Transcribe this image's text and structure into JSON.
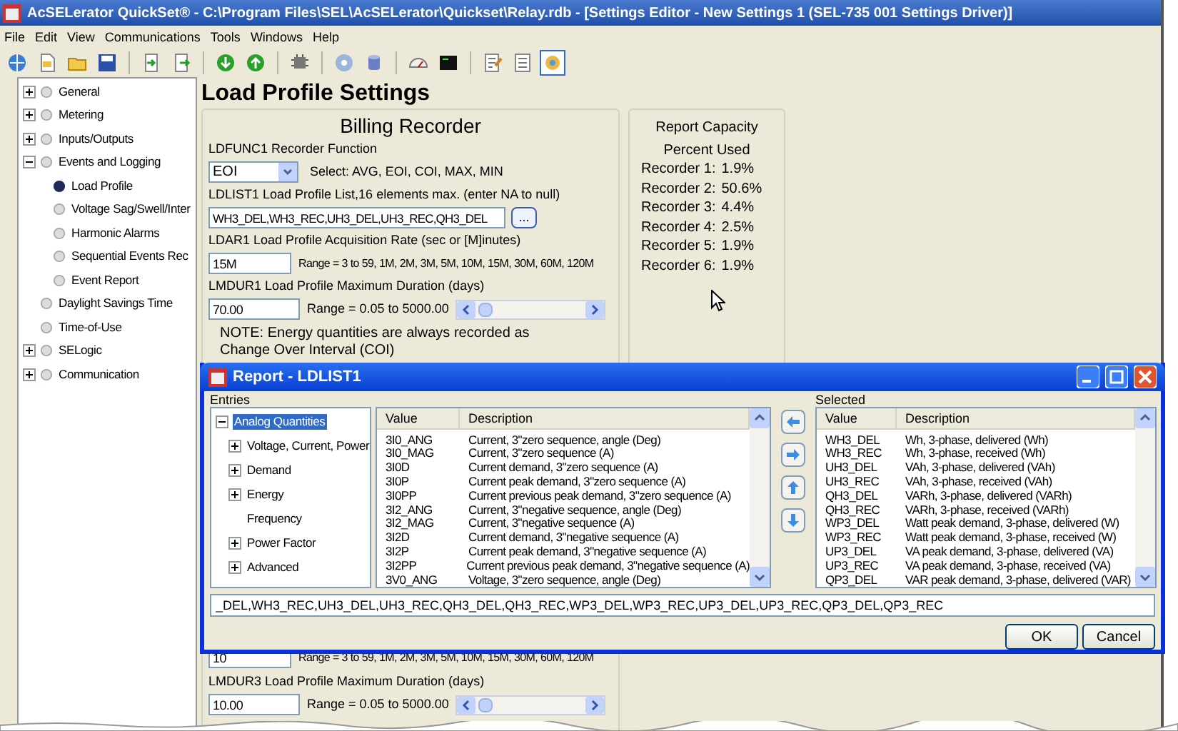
{
  "window": {
    "title": "AcSELerator QuickSet® - C:\\Program Files\\SEL\\AcSELerator\\Quickset\\Relay.rdb - [Settings Editor - New Settings 1 (SEL-735 001 Settings Driver)]"
  },
  "menu": [
    "File",
    "Edit",
    "View",
    "Communications",
    "Tools",
    "Windows",
    "Help"
  ],
  "toolbar": [
    {
      "kind": "button",
      "selected": false
    },
    {
      "kind": "button",
      "selected": false
    },
    {
      "kind": "button",
      "selected": false
    },
    {
      "kind": "button",
      "selected": false
    },
    {
      "kind": "separator"
    },
    {
      "kind": "button",
      "selected": false
    },
    {
      "kind": "button",
      "selected": false
    },
    {
      "kind": "separator"
    },
    {
      "kind": "button",
      "selected": false
    },
    {
      "kind": "button",
      "selected": false
    },
    {
      "kind": "separator"
    },
    {
      "kind": "button",
      "selected": false
    },
    {
      "kind": "separator"
    },
    {
      "kind": "button",
      "selected": false
    },
    {
      "kind": "button",
      "selected": false
    },
    {
      "kind": "separator"
    },
    {
      "kind": "button",
      "selected": false
    },
    {
      "kind": "button",
      "selected": false
    },
    {
      "kind": "separator"
    },
    {
      "kind": "button",
      "selected": false
    },
    {
      "kind": "button",
      "selected": false
    },
    {
      "kind": "button",
      "selected": true
    }
  ],
  "tree": [
    {
      "label": "General",
      "expanded": false,
      "selected": false
    },
    {
      "label": "Metering",
      "expanded": false,
      "selected": false
    },
    {
      "label": "Inputs/Outputs",
      "expanded": false,
      "selected": false
    },
    {
      "label": "Events and Logging",
      "expanded": true,
      "selected": false,
      "children": [
        {
          "label": "Load Profile",
          "selected": true
        },
        {
          "label": "Voltage Sag/Swell/Inter",
          "selected": false
        },
        {
          "label": "Harmonic Alarms",
          "selected": false
        },
        {
          "label": "Sequential Events Rec",
          "selected": false
        },
        {
          "label": "Event Report",
          "selected": false
        }
      ]
    },
    {
      "label": "Daylight Savings Time",
      "selected": false
    },
    {
      "label": "Time-of-Use",
      "selected": false
    },
    {
      "label": "SELogic",
      "expanded": false,
      "selected": false
    },
    {
      "label": "Communication",
      "expanded": false,
      "selected": false
    }
  ],
  "page_title": "Load Profile Settings",
  "billing_recorder": {
    "title": "Billing Recorder",
    "rows": [
      {
        "kind": "combo",
        "label": "LDFUNC1 Recorder Function",
        "value": "EOI",
        "hint": "Select: AVG, EOI, COI, MAX, MIN"
      },
      {
        "kind": "list",
        "label": "LDLIST1 Load Profile List,16 elements max. (enter NA to null)",
        "value": "WH3_DEL,WH3_REC,UH3_DEL,UH3_REC,QH3_DEL",
        "button": "..."
      },
      {
        "kind": "text",
        "label": "LDAR1 Load Profile Acquisition Rate (sec or [M]inutes)",
        "value": "15M",
        "hint": "Range = 3 to 59, 1M, 2M, 3M, 5M, 10M, 15M, 30M, 60M, 120M"
      },
      {
        "kind": "slider",
        "label": "LMDUR1 Load Profile Maximum Duration (days)",
        "value": "70.00",
        "hint": "Range = 0.05 to 5000.00"
      }
    ],
    "note": "NOTE: Energy quantities are always recorded as Change Over Interval (COI)"
  },
  "report_capacity": {
    "title": "Report Capacity",
    "subtitle": "Percent Used",
    "recorders": [
      {
        "label": "Recorder 1:",
        "value": "1.9%"
      },
      {
        "label": "Recorder 2:",
        "value": "50.6%"
      },
      {
        "label": "Recorder 3:",
        "value": "4.4%"
      },
      {
        "label": "Recorder 4:",
        "value": "2.5%"
      },
      {
        "label": "Recorder 5:",
        "value": "1.9%"
      },
      {
        "label": "Recorder 6:",
        "value": "1.9%"
      }
    ]
  },
  "lower_recorder": {
    "rows": [
      {
        "kind": "text",
        "value": "10",
        "hint": "Range = 3 to 59, 1M, 2M, 3M, 5M, 10M, 15M, 30M, 60M, 120M"
      },
      {
        "kind": "slider",
        "label": "LMDUR3 Load Profile Maximum Duration (days)",
        "value": "10.00",
        "hint": "Range = 0.05 to 5000.00"
      }
    ]
  },
  "dialog": {
    "title": "Report - LDLIST1",
    "entries_label": "Entries",
    "selected_label": "Selected",
    "entries_tree": [
      {
        "label": "Analog Quantities",
        "expanded": true,
        "selected": true,
        "children": [
          {
            "label": "Voltage, Current, Power",
            "expanded": false,
            "selected": false
          },
          {
            "label": "Demand",
            "expanded": false,
            "selected": false
          },
          {
            "label": "Energy",
            "expanded": false,
            "selected": false
          },
          {
            "label": "Frequency",
            "selected": false
          },
          {
            "label": "Power Factor",
            "expanded": false,
            "selected": false
          },
          {
            "label": "Advanced",
            "expanded": false,
            "selected": false
          }
        ]
      }
    ],
    "entries_columns": [
      "Value",
      "Description"
    ],
    "entries_rows": [
      [
        "3I0_ANG",
        "Current, 3\"zero sequence, angle (Deg)"
      ],
      [
        "3I0_MAG",
        "Current, 3\"zero sequence (A)"
      ],
      [
        "3I0D",
        "Current demand, 3\"zero sequence (A)"
      ],
      [
        "3I0P",
        "Current peak demand, 3\"zero sequence (A)"
      ],
      [
        "3I0PP",
        "Current previous peak demand, 3\"zero sequence (A)"
      ],
      [
        "3I2_ANG",
        "Current, 3\"negative sequence, angle (Deg)"
      ],
      [
        "3I2_MAG",
        "Current, 3\"negative sequence (A)"
      ],
      [
        "3I2D",
        "Current demand, 3\"negative sequence (A)"
      ],
      [
        "3I2P",
        "Current peak demand, 3\"negative sequence (A)"
      ],
      [
        "3I2PP",
        "Current previous peak demand, 3\"negative sequence (A)"
      ],
      [
        "3V0_ANG",
        "Voltage, 3\"zero sequence, angle (Deg)"
      ]
    ],
    "selected_columns": [
      "Value",
      "Description"
    ],
    "selected_rows": [
      [
        "WH3_DEL",
        "Wh, 3-phase, delivered (Wh)"
      ],
      [
        "WH3_REC",
        "Wh, 3-phase, received (Wh)"
      ],
      [
        "UH3_DEL",
        "VAh, 3-phase, delivered (VAh)"
      ],
      [
        "UH3_REC",
        "VAh, 3-phase, received (VAh)"
      ],
      [
        "QH3_DEL",
        "VARh, 3-phase, delivered (VARh)"
      ],
      [
        "QH3_REC",
        "VARh, 3-phase, received (VARh)"
      ],
      [
        "WP3_DEL",
        "Watt peak demand, 3-phase, delivered (W)"
      ],
      [
        "WP3_REC",
        "Watt peak demand, 3-phase, received (W)"
      ],
      [
        "UP3_DEL",
        "VA peak demand, 3-phase, delivered (VA)"
      ],
      [
        "UP3_REC",
        "VA peak demand, 3-phase, received (VA)"
      ],
      [
        "QP3_DEL",
        "VAR peak demand, 3-phase, delivered (VAR)"
      ]
    ],
    "list_value": "_DEL,WH3_REC,UH3_DEL,UH3_REC,QH3_DEL,QH3_REC,WP3_DEL,WP3_REC,UP3_DEL,UP3_REC,QP3_DEL,QP3_REC",
    "buttons": [
      "OK",
      "Cancel"
    ]
  }
}
